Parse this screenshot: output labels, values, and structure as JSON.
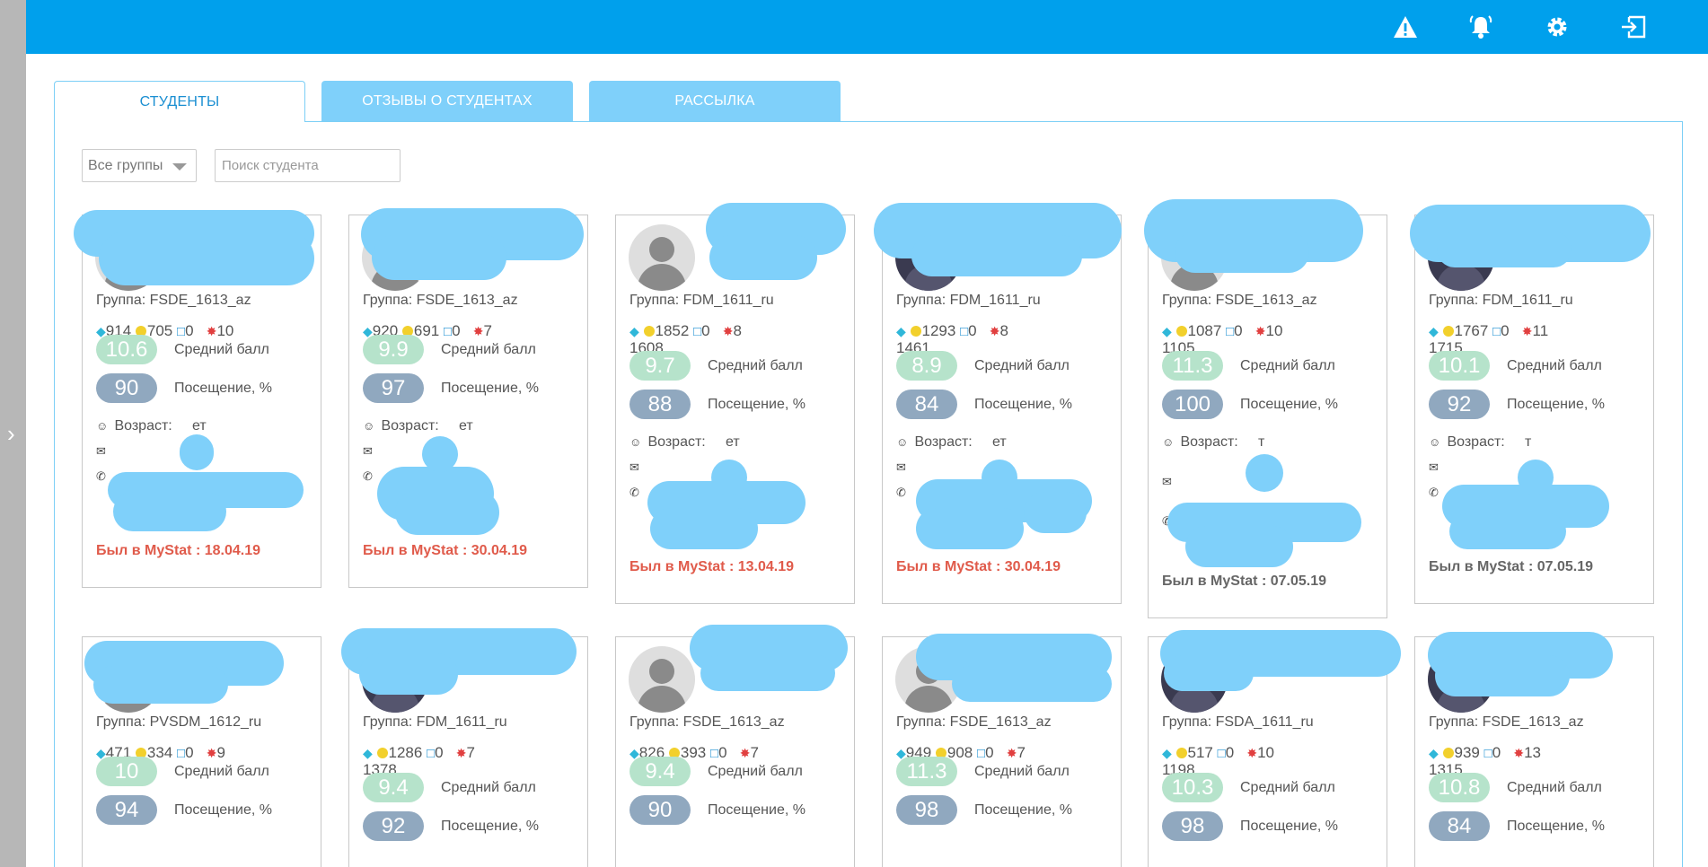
{
  "sidebar": {
    "toggle_icon": "chevron-right-icon"
  },
  "topbar": {
    "icons": [
      "warning-icon",
      "bell-icon",
      "settings-gear-icon",
      "logout-icon"
    ],
    "color": "#00a0ec"
  },
  "tabs": [
    {
      "label": "СТУДЕНТЫ",
      "active": true
    },
    {
      "label": "ОТЗЫВЫ О СТУДЕНТАХ",
      "active": false
    },
    {
      "label": "РАССЫЛКА",
      "active": false
    }
  ],
  "filters": {
    "group_select": "Все группы",
    "search_placeholder": "Поиск студента"
  },
  "labels": {
    "avg": "Средний балл",
    "attendance": "Посещение, %",
    "age": "Возраст:",
    "age_tail_1": "ет",
    "age_tail_2": "т",
    "last_visit": "Был в MyStat :"
  },
  "students": [
    {
      "group": "Группа: FSDE_1613_az",
      "gems": "914",
      "coins": "705",
      "msgs": "0",
      "virus": "10",
      "avg": "10.6",
      "attendance": "90",
      "last_date": "18.04.19"
    },
    {
      "group": "Группа: FSDE_1613_az",
      "gems": "920",
      "coins": "691",
      "msgs": "0",
      "virus": "7",
      "avg": "9.9",
      "attendance": "97",
      "last_date": "30.04.19"
    },
    {
      "group": "Группа: FDM_1611_ru",
      "gems": "1608",
      "coins": "1852",
      "msgs": "0",
      "virus": "8",
      "avg": "9.7",
      "attendance": "88",
      "last_date": "13.04.19"
    },
    {
      "group": "Группа: FDM_1611_ru",
      "gems": "1461",
      "coins": "1293",
      "msgs": "0",
      "virus": "8",
      "avg": "8.9",
      "attendance": "84",
      "last_date": "30.04.19"
    },
    {
      "group": "Группа: FSDE_1613_az",
      "gems": "1105",
      "coins": "1087",
      "msgs": "0",
      "virus": "10",
      "avg": "11.3",
      "attendance": "100",
      "last_date": "07.05.19"
    },
    {
      "group": "Группа: FDM_1611_ru",
      "gems": "1715",
      "coins": "1767",
      "msgs": "0",
      "virus": "11",
      "avg": "10.1",
      "attendance": "92",
      "last_date": "07.05.19"
    },
    {
      "group": "Группа: PVSDM_1612_ru",
      "gems": "471",
      "coins": "334",
      "msgs": "0",
      "virus": "9",
      "avg": "10",
      "attendance": "94"
    },
    {
      "group": "Группа: FDM_1611_ru",
      "gems": "1378",
      "coins": "1286",
      "msgs": "0",
      "virus": "7",
      "avg": "9.4",
      "attendance": "92"
    },
    {
      "group": "Группа: FSDE_1613_az",
      "gems": "826",
      "coins": "393",
      "msgs": "0",
      "virus": "7",
      "avg": "9.4",
      "attendance": "90"
    },
    {
      "group": "Группа: FSDE_1613_az",
      "gems": "949",
      "coins": "908",
      "msgs": "0",
      "virus": "7",
      "avg": "11.3",
      "attendance": "98"
    },
    {
      "group": "Группа: FSDA_1611_ru",
      "gems": "1198",
      "coins": "517",
      "msgs": "0",
      "virus": "10",
      "avg": "10.3",
      "attendance": "98"
    },
    {
      "group": "Группа: FSDE_1613_az",
      "gems": "1315",
      "coins": "939",
      "msgs": "0",
      "virus": "13",
      "avg": "10.8",
      "attendance": "84"
    }
  ]
}
